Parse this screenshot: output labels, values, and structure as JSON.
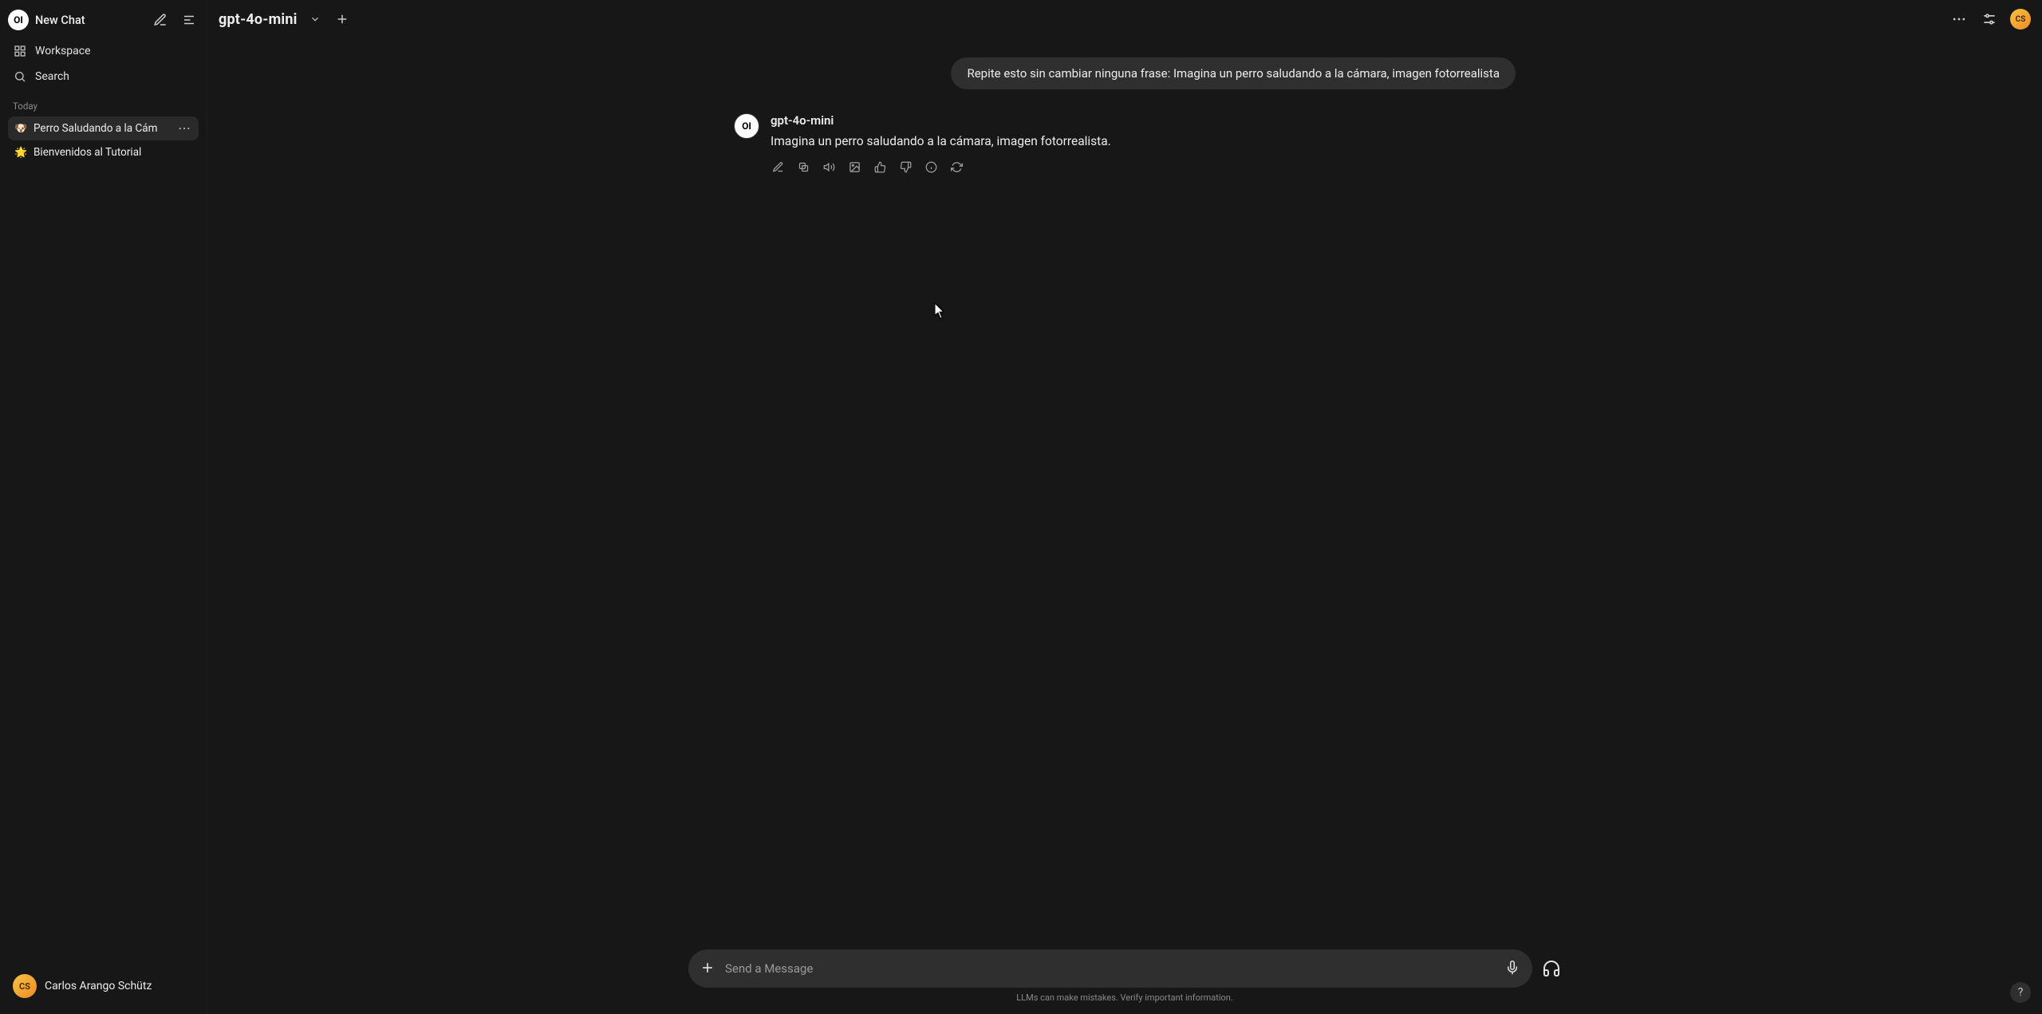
{
  "sidebar": {
    "logo_text": "OI",
    "new_chat": "New Chat",
    "workspace": "Workspace",
    "search": "Search",
    "section_today": "Today",
    "chats": [
      {
        "emoji": "🐶",
        "title": "Perro Saludando a la Cám",
        "active": true
      },
      {
        "emoji": "🌟",
        "title": "Bienvenidos al Tutorial",
        "active": false
      }
    ],
    "user_initials": "CS",
    "user_name": "Carlos Arango Schütz"
  },
  "topbar": {
    "model": "gpt-4o-mini",
    "avatar_initials": "CS"
  },
  "conversation": {
    "user_message": "Repite esto sin cambiar ninguna frase: Imagina un perro saludando a la cámara, imagen fotorrealista",
    "assistant": {
      "avatar_text": "OI",
      "name": "gpt-4o-mini",
      "text": "Imagina un perro saludando a la cámara, imagen fotorrealista."
    }
  },
  "composer": {
    "placeholder": "Send a Message"
  },
  "footer": {
    "disclaimer": "LLMs can make mistakes. Verify important information."
  },
  "help": "?"
}
